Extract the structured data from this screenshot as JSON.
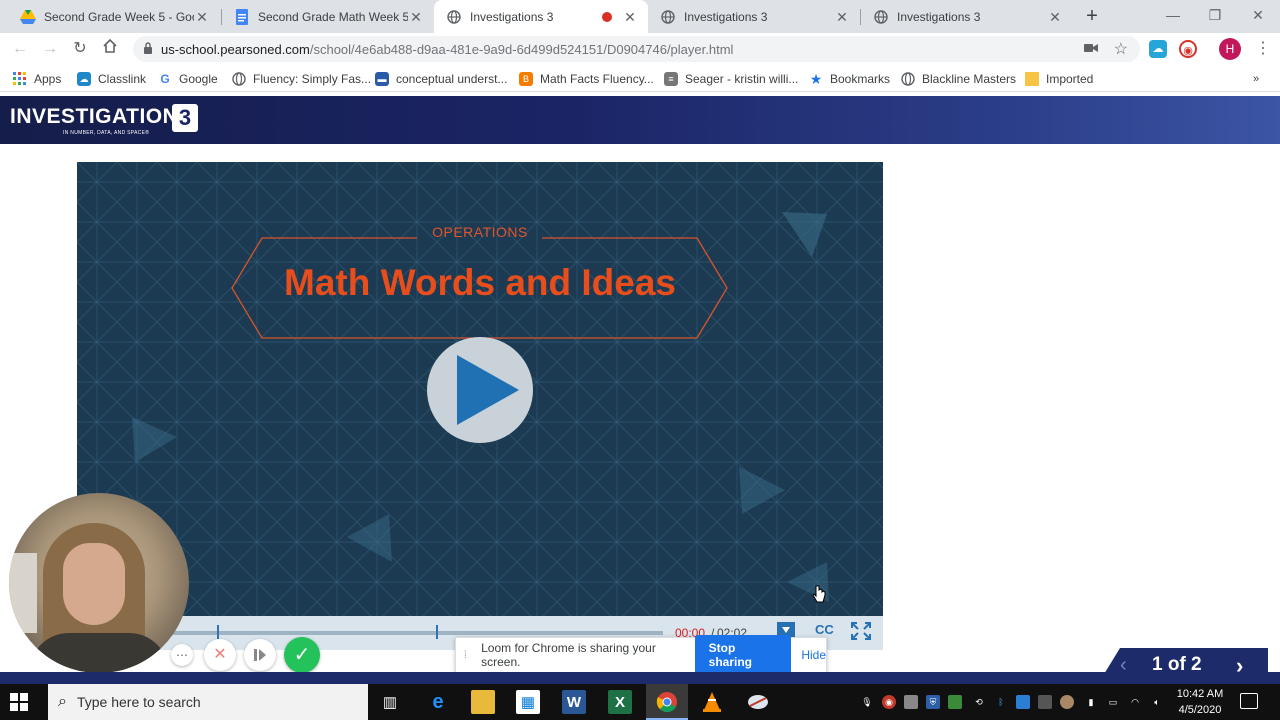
{
  "browser": {
    "tabs": [
      {
        "title": "Second Grade Week 5 - Googl",
        "favicon": "google-drive-icon",
        "active": false
      },
      {
        "title": "Second Grade Math Week 5 - G",
        "favicon": "google-docs-icon",
        "active": false
      },
      {
        "title": "Investigations 3",
        "favicon": "globe-icon",
        "active": true,
        "recording": true
      },
      {
        "title": "Investigations 3",
        "favicon": "globe-icon",
        "active": false
      },
      {
        "title": "Investigations 3",
        "favicon": "globe-icon",
        "active": false
      }
    ],
    "url_host": "us-school.pearsoned.com",
    "url_path": "/school/4e6ab488-d9aa-481e-9a9d-6d499d524151/D0904746/player.html",
    "profile_initial": "H",
    "bookmarks": [
      {
        "label": "Apps",
        "icon": "apps-grid-icon",
        "color": "#4285f4"
      },
      {
        "label": "Classlink",
        "icon": "classlink-icon",
        "color": "#1e88c8"
      },
      {
        "label": "Google",
        "icon": "google-icon",
        "color": "#4285f4"
      },
      {
        "label": "Fluency: Simply Fas...",
        "icon": "globe-icon",
        "color": "#5f6368"
      },
      {
        "label": "conceptual underst...",
        "icon": "site-icon",
        "color": "#2a5aa8"
      },
      {
        "label": "Math Facts Fluency...",
        "icon": "blogger-icon",
        "color": "#f57c00"
      },
      {
        "label": "Seager - kristin willi...",
        "icon": "site-icon",
        "color": "#777"
      },
      {
        "label": "Bookmarks",
        "icon": "star-icon",
        "color": "#1a73e8"
      },
      {
        "label": "Blackline Masters",
        "icon": "globe-icon",
        "color": "#5f6368"
      },
      {
        "label": "Imported",
        "icon": "folder-icon",
        "color": "#f6c344"
      }
    ]
  },
  "header": {
    "logo_text": "INVESTIGATIONS",
    "logo_subtitle": "IN NUMBER, DATA, AND SPACE®",
    "logo_number": "3"
  },
  "video": {
    "category": "OPERATIONS",
    "title": "Math Words and Ideas",
    "current_time": "00:00",
    "separator": "/",
    "total_time": "02:02",
    "cc_label": "CC"
  },
  "loom": {
    "share_message": "Loom for Chrome is sharing your screen.",
    "stop_label": "Stop sharing",
    "hide_label": "Hide"
  },
  "pagination": {
    "label": "1 of 2"
  },
  "taskbar": {
    "search_placeholder": "Type here to search",
    "time": "10:42 AM",
    "date": "4/5/2020"
  }
}
